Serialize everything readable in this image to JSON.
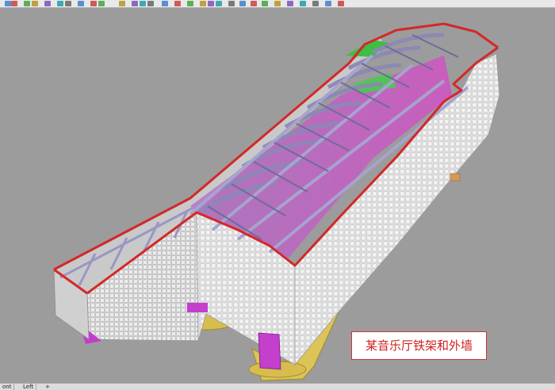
{
  "viewport": {
    "caption": "某音乐厅铁架和外墙"
  },
  "tabs": [
    {
      "label": "ont"
    },
    {
      "label": "Left"
    },
    {
      "label": "+"
    }
  ],
  "toolbar": {
    "icons": [
      "select-icon",
      "point-icon",
      "line-icon",
      "curve-icon",
      "circle-icon",
      "arc-icon",
      "rectangle-icon",
      "polygon-icon",
      "text-icon",
      "hatch-icon",
      "surface-icon",
      "extrude-icon",
      "solid-icon",
      "mesh-icon",
      "render-icon",
      "light-icon",
      "dimension-icon",
      "transform-icon",
      "array-icon",
      "trim-icon",
      "split-icon",
      "join-icon",
      "explode-icon",
      "group-icon",
      "analyze-icon",
      "grid-icon",
      "snap-icon",
      "layer-icon",
      "properties-icon",
      "help-icon"
    ]
  },
  "colors": {
    "viewport_bg": "#9c9c9c",
    "wall": "#e8e8e8",
    "frame": "#a6a2c8",
    "edge_highlight": "#d42828",
    "accent_magenta": "#c035c8",
    "accent_green": "#40c040",
    "foundation": "#d8c050"
  }
}
